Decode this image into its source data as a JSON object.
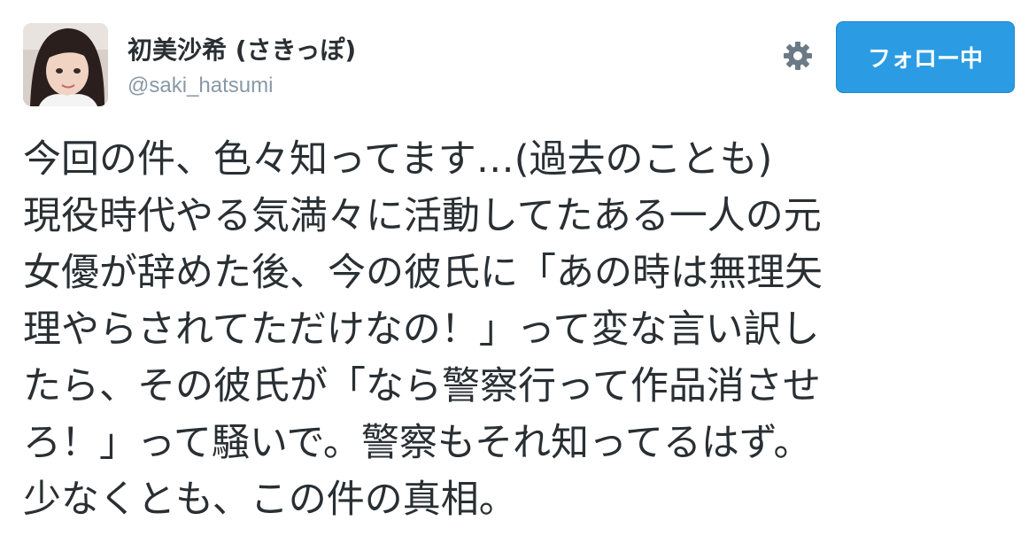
{
  "user": {
    "display_name": "初美沙希 (さきっぽ)",
    "screen_name": "@saki_hatsumi"
  },
  "actions": {
    "settings_icon": "gear-icon",
    "follow_label": "フォロー中"
  },
  "tweet": {
    "lines": [
      "今回の件、色々知ってます…(過去のことも)",
      "現役時代やる気満々に活動してたある一人の元",
      "女優が辞めた後、今の彼氏に「あの時は無理矢",
      "理やらされてただけなの！」って変な言い訳し",
      "たら、その彼氏が「なら警察行って作品消させ",
      "ろ！」って騒いで。警察もそれ知ってるはず。",
      "少なくとも、この件の真相。"
    ]
  },
  "colors": {
    "follow_button": "#2b9ce3",
    "text": "#292f33",
    "secondary_text": "#8899a6",
    "icon": "#6b7a85"
  }
}
